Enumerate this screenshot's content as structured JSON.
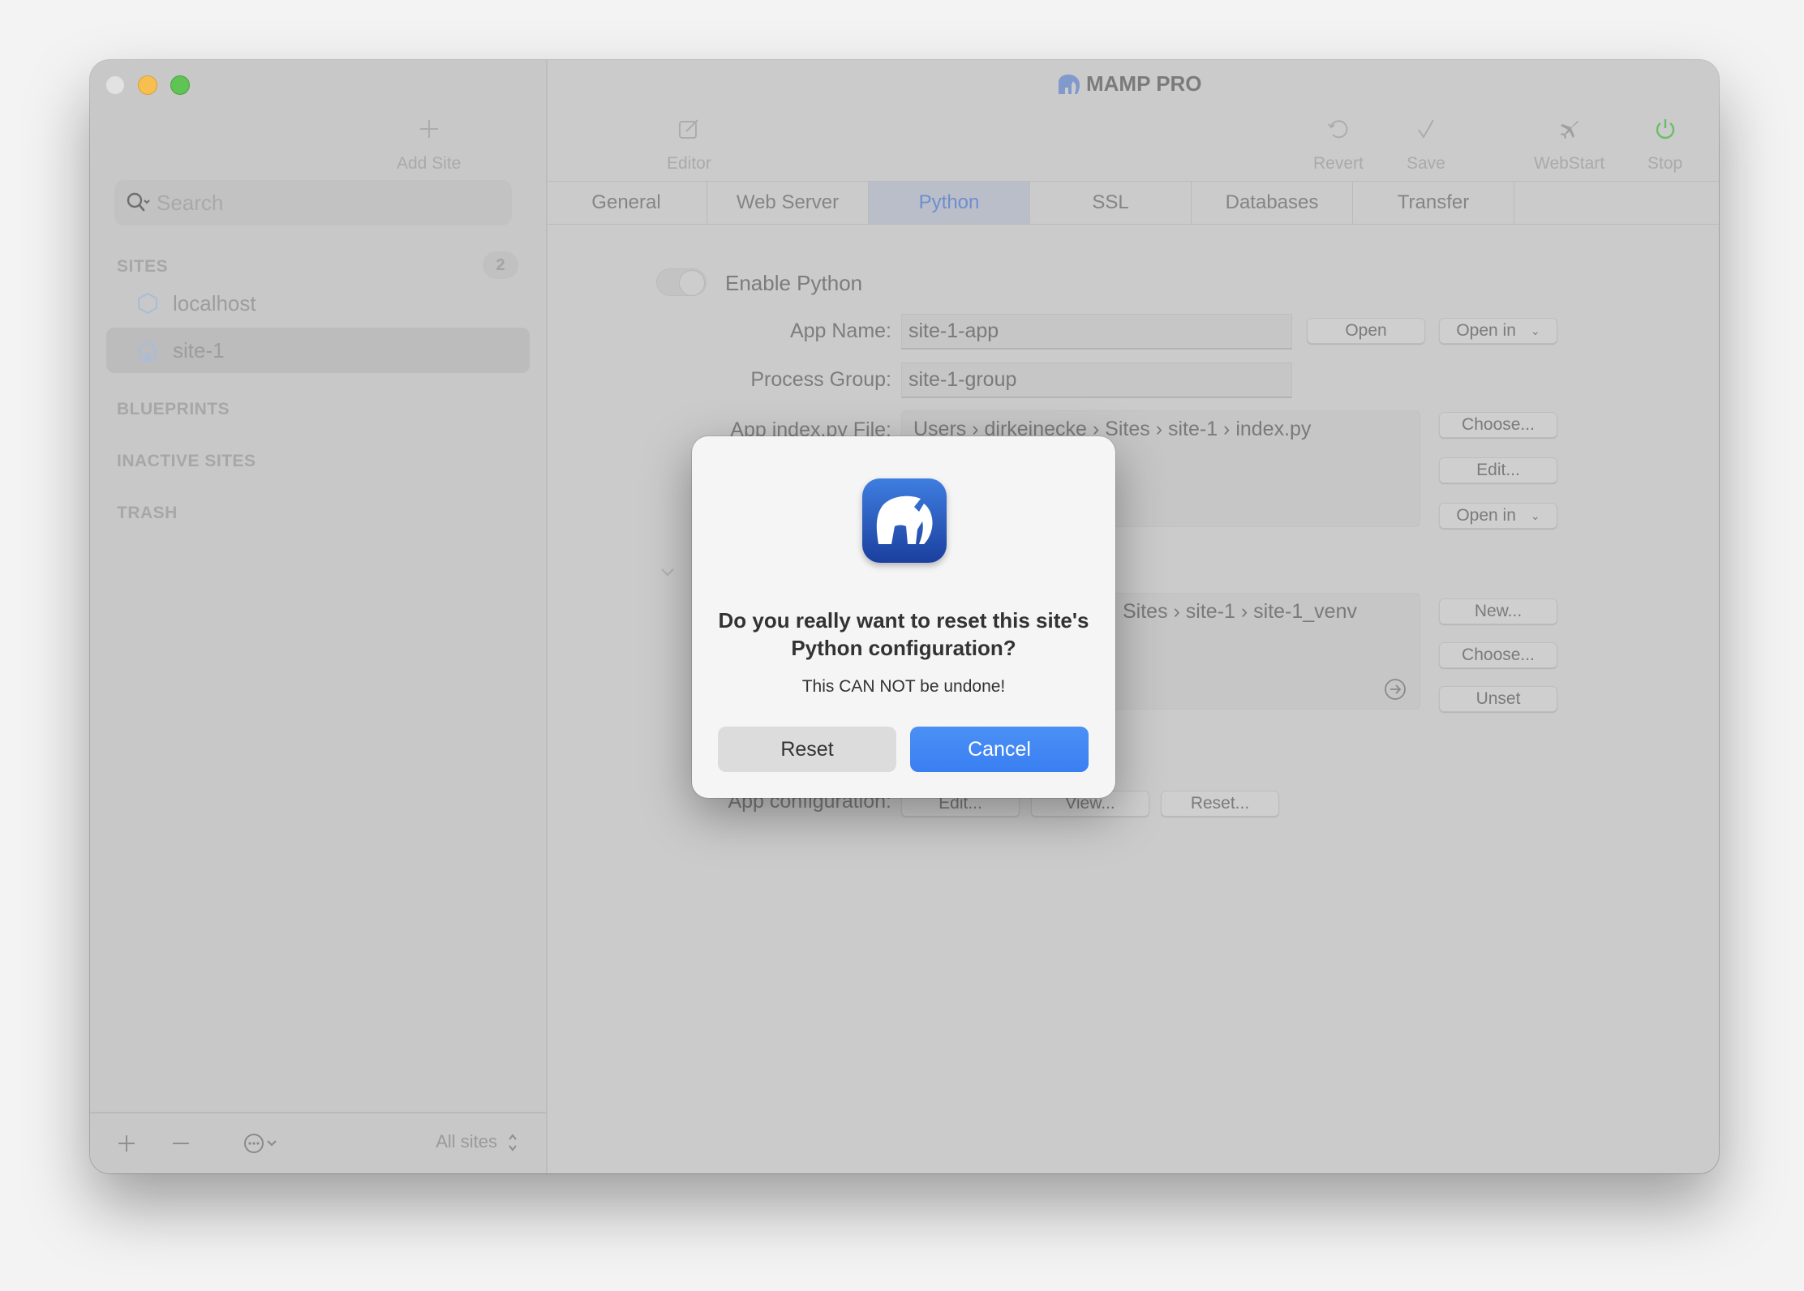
{
  "window": {
    "title": "MAMP PRO",
    "traffic_lights": [
      "close",
      "minimize",
      "maximize"
    ]
  },
  "sidebar": {
    "search_placeholder": "Search",
    "sections": {
      "sites": {
        "label": "SITES",
        "count": "2"
      },
      "blueprints": {
        "label": "BLUEPRINTS"
      },
      "inactive": {
        "label": "INACTIVE SITES"
      },
      "trash": {
        "label": "TRASH"
      }
    },
    "sites": [
      {
        "label": "localhost",
        "icon": "hexagon-icon",
        "selected": false
      },
      {
        "label": "site-1",
        "icon": "house-icon",
        "selected": true
      }
    ],
    "footer": {
      "add": "+",
      "remove": "—",
      "filter_label": "All sites"
    }
  },
  "toolbar": {
    "add_site": "Add Site",
    "editor": "Editor",
    "revert": "Revert",
    "save": "Save",
    "webstart": "WebStart",
    "stop": "Stop",
    "stop_color": "#6bbf6a"
  },
  "tabs": [
    {
      "label": "General",
      "active": false
    },
    {
      "label": "Web Server",
      "active": false
    },
    {
      "label": "Python",
      "active": true
    },
    {
      "label": "SSL",
      "active": false
    },
    {
      "label": "Databases",
      "active": false
    },
    {
      "label": "Transfer",
      "active": false
    }
  ],
  "python": {
    "enable_label": "Enable Python",
    "enabled": false,
    "app_name_label": "App Name:",
    "app_name_value": "site-1-app",
    "open_button": "Open",
    "open_in_button": "Open in",
    "process_group_label": "Process Group:",
    "process_group_value": "site-1-group",
    "index_file_label": "App index.py File:",
    "index_file_path": "Users › dirkeinecke › Sites › site-1 › index.py",
    "choose_button": "Choose...",
    "edit_button": "Edit...",
    "open_in_button_2": "Open in",
    "venv_path": "Sites › site-1 › site-1_venv",
    "new_button": "New...",
    "choose_button_2": "Choose...",
    "unset_button": "Unset",
    "app_config_label": "App configuration:",
    "config_edit": "Edit...",
    "config_view": "View...",
    "config_reset": "Reset..."
  },
  "dialog": {
    "title": "Do you really want to reset this site's Python configuration?",
    "message": "This CAN NOT be undone!",
    "reset_button": "Reset",
    "cancel_button": "Cancel",
    "accent": "#3a7ff2"
  }
}
